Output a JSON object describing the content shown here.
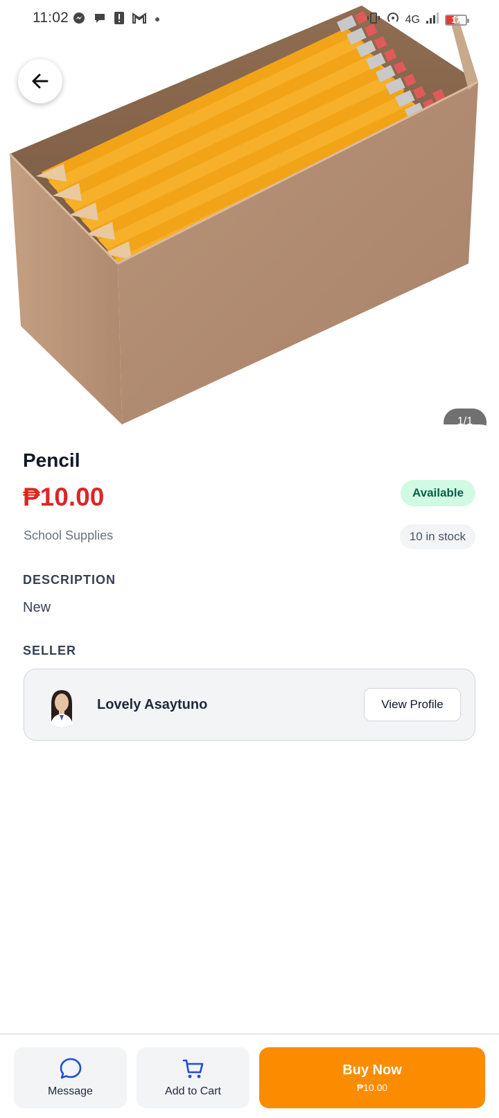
{
  "status_bar": {
    "time": "11:02",
    "network": "4G",
    "battery": "17",
    "icons": [
      "messenger-icon",
      "chat-icon",
      "alert-icon",
      "gmail-icon",
      "dot-icon",
      "vibrate-icon",
      "hotspot-icon",
      "signal-icon",
      "battery-icon"
    ]
  },
  "gallery": {
    "counter": "1/1"
  },
  "product": {
    "title": "Pencil",
    "price": "₱10.00",
    "availability": "Available",
    "category": "School Supplies",
    "stock": "10 in stock"
  },
  "description": {
    "label": "DESCRIPTION",
    "text": "New"
  },
  "seller": {
    "label": "SELLER",
    "name": "Lovely Asaytuno",
    "view_profile_label": "View Profile"
  },
  "actions": {
    "message_label": "Message",
    "cart_label": "Add to Cart",
    "buy_label": "Buy Now",
    "buy_price": "₱10.00"
  },
  "colors": {
    "price": "#dc2626",
    "buy_button": "#fb8c00",
    "available_badge": "#d1fae5",
    "icon_blue": "#1d4ed8"
  }
}
